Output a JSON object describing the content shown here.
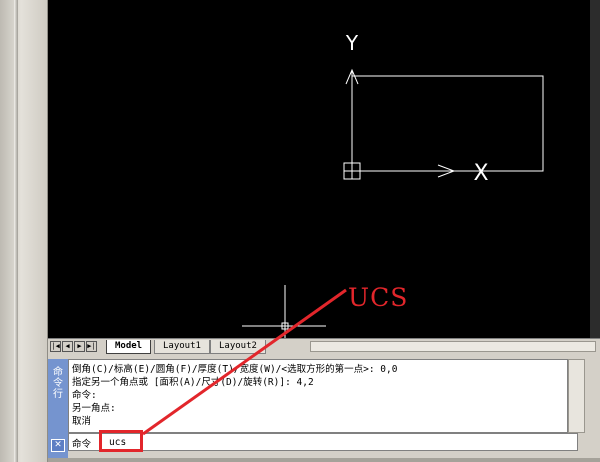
{
  "viewport": {
    "ucs_icon": {
      "y_label": "Y",
      "x_label": "X"
    }
  },
  "layout_tabs": {
    "nav_buttons": [
      "|◀",
      "◀",
      "▶",
      "▶|"
    ],
    "tabs": [
      {
        "label": "Model",
        "active": true
      },
      {
        "label": "Layout1",
        "active": false
      },
      {
        "label": "Layout2",
        "active": false
      }
    ]
  },
  "command_window": {
    "title": "命令行",
    "history": [
      "倒角(C)/标高(E)/圆角(F)/厚度(T)/宽度(W)/<选取方形的第一点>: 0,0",
      "指定另一个角点或 [面积(A)/尺寸(D)/旋转(R)]: 4,2",
      "命令:",
      "另一角点:",
      "取消"
    ],
    "prompt": "命令",
    "input_value": "ucs"
  },
  "annotation": {
    "label": "UCS",
    "color": "#e2262b"
  },
  "colors": {
    "drawing_background": "#000000",
    "drawing_lines": "#ffffff",
    "command_side_panel": "#7594cf"
  }
}
